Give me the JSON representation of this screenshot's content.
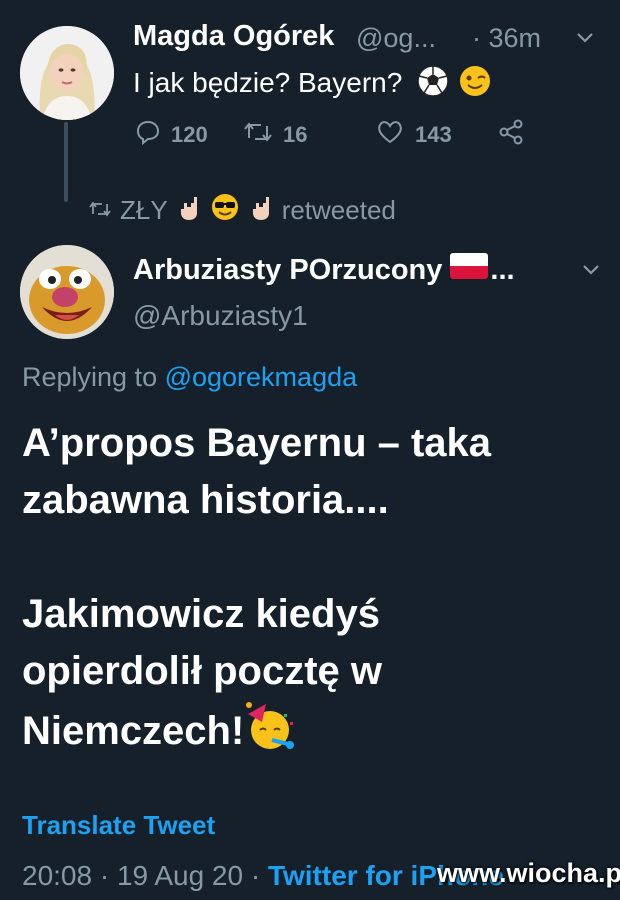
{
  "tweet1": {
    "name": "Magda Ogórek",
    "handle": "@og...",
    "time": "· 36m",
    "text": "I jak będzie? Bayern?",
    "text_emoji": [
      "soccer-ball",
      "winking-face"
    ],
    "replies": "120",
    "retweets": "16",
    "likes": "143"
  },
  "retweet_context": {
    "name": "ZŁY",
    "emojis": [
      "sign-of-horns",
      "smiling-face-with-sunglasses",
      "sign-of-horns"
    ],
    "suffix": "retweeted"
  },
  "tweet2": {
    "name": "Arbuziasty POrzucony",
    "name_suffix": "...",
    "flag": "poland-flag",
    "handle": "@Arbuziasty1",
    "replying_prefix": "Replying to ",
    "replying_mention": "@ogorekmagda",
    "paragraph1": "A’propos Bayernu – taka zabawna historia....",
    "paragraph2": "Jakimowicz kiedyś opierdolił pocztę w Niemczech!",
    "paragraph2_emoji": "partying-face",
    "translate": "Translate Tweet",
    "timestamp": "20:08 · 19 Aug 20 · ",
    "client": "Twitter for iPhone"
  },
  "watermark": "www.wiocha.pl",
  "colors": {
    "background": "#15202b",
    "secondary_text": "#8899a6",
    "link": "#1da1f2"
  }
}
